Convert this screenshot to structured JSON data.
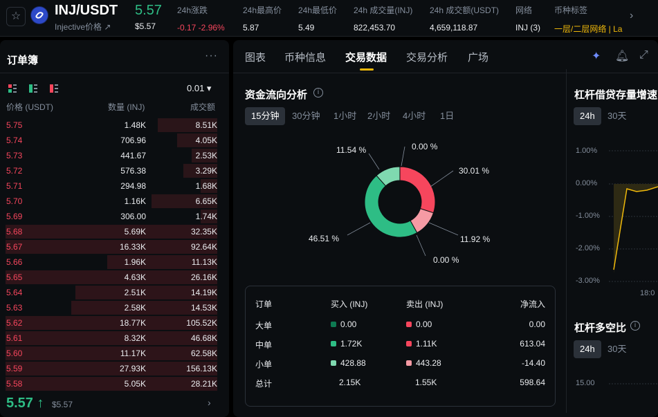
{
  "header": {
    "pair": "INJ/USDT",
    "subtitle": "Injective价格 ↗",
    "price": "5.57",
    "price_usd": "$5.57",
    "stats": [
      {
        "label": "24h涨跌",
        "value": "-0.17 -2.96%",
        "color": "#f6465d"
      },
      {
        "label": "24h最高价",
        "value": "5.87"
      },
      {
        "label": "24h最低价",
        "value": "5.49"
      },
      {
        "label": "24h 成交量(INJ)",
        "value": "822,453.70"
      },
      {
        "label": "24h 成交额(USDT)",
        "value": "4,659,118.87"
      },
      {
        "label": "网络",
        "value": "INJ (3)"
      },
      {
        "label": "币种标签",
        "value": "一层/二层网络 | La",
        "color": "#f0b90b"
      }
    ]
  },
  "orderbook": {
    "title": "订单簿",
    "tick": "0.01 ▾",
    "headers": [
      "价格 (USDT)",
      "数量 (INJ)",
      "成交额"
    ],
    "rows": [
      {
        "p": "5.75",
        "q": "1.48K",
        "t": "8.51K",
        "w": 0.28
      },
      {
        "p": "5.74",
        "q": "706.96",
        "t": "4.05K",
        "w": 0.19
      },
      {
        "p": "5.73",
        "q": "441.67",
        "t": "2.53K",
        "w": 0.12
      },
      {
        "p": "5.72",
        "q": "576.38",
        "t": "3.29K",
        "w": 0.16
      },
      {
        "p": "5.71",
        "q": "294.98",
        "t": "1.68K",
        "w": 0.08
      },
      {
        "p": "5.70",
        "q": "1.16K",
        "t": "6.65K",
        "w": 0.31
      },
      {
        "p": "5.69",
        "q": "306.00",
        "t": "1.74K",
        "w": 0.08
      },
      {
        "p": "5.68",
        "q": "5.69K",
        "t": "32.35K",
        "w": 1.0
      },
      {
        "p": "5.67",
        "q": "16.33K",
        "t": "92.64K",
        "w": 1.0
      },
      {
        "p": "5.66",
        "q": "1.96K",
        "t": "11.13K",
        "w": 0.52
      },
      {
        "p": "5.65",
        "q": "4.63K",
        "t": "26.16K",
        "w": 1.0
      },
      {
        "p": "5.64",
        "q": "2.51K",
        "t": "14.19K",
        "w": 0.67
      },
      {
        "p": "5.63",
        "q": "2.58K",
        "t": "14.53K",
        "w": 0.69
      },
      {
        "p": "5.62",
        "q": "18.77K",
        "t": "105.52K",
        "w": 1.0
      },
      {
        "p": "5.61",
        "q": "8.32K",
        "t": "46.68K",
        "w": 1.0
      },
      {
        "p": "5.60",
        "q": "11.17K",
        "t": "62.58K",
        "w": 1.0
      },
      {
        "p": "5.59",
        "q": "27.93K",
        "t": "156.13K",
        "w": 1.0
      },
      {
        "p": "5.58",
        "q": "5.05K",
        "t": "28.21K",
        "w": 1.0
      }
    ],
    "last_price": "5.57 ↑",
    "last_usd": "$5.57"
  },
  "tabs": [
    "图表",
    "币种信息",
    "交易数据",
    "交易分析",
    "广场"
  ],
  "flow": {
    "title": "资金流向分析",
    "periods": [
      "15分钟",
      "30分钟",
      "1小时",
      "2小时",
      "4小时",
      "1日"
    ],
    "labels": [
      "11.54 %",
      "0.00 %",
      "30.01 %",
      "11.92 %",
      "0.00 %",
      "46.51 %"
    ],
    "table": {
      "headers": [
        "订单",
        "买入 (INJ)",
        "卖出 (INJ)",
        "净流入"
      ],
      "rows": [
        {
          "n": "大单",
          "b": "0.00",
          "s": "0.00",
          "net": "0.00",
          "bc": "#0e7a52",
          "sc": "#f6465d"
        },
        {
          "n": "中单",
          "b": "1.72K",
          "s": "1.11K",
          "net": "613.04",
          "bc": "#2ebd85",
          "sc": "#f6465d"
        },
        {
          "n": "小单",
          "b": "428.88",
          "s": "443.28",
          "net": "-14.40",
          "bc": "#7fd9b0",
          "sc": "#f59aa4"
        },
        {
          "n": "总计",
          "b": "2.15K",
          "s": "1.55K",
          "net": "598.64"
        }
      ]
    }
  },
  "leverage": {
    "title1": "杠杆借贷存量增速",
    "periods1": [
      "24h",
      "30天"
    ],
    "yticks": [
      "1.00%",
      "0.00%",
      "-1.00%",
      "-2.00%",
      "-3.00%"
    ],
    "xtick": "18:0",
    "title2": "杠杆多空比",
    "periods2": [
      "24h",
      "30天"
    ],
    "ytick2": "15.00"
  }
}
